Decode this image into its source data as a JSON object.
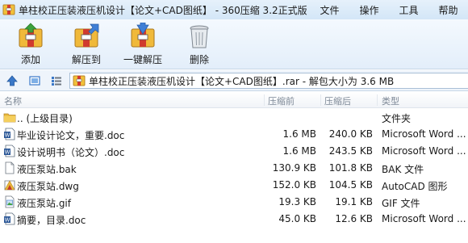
{
  "window": {
    "title": "单柱校正压装液压机设计【论文+CAD图纸】 - 360压缩 3.2正式版",
    "menu": [
      "文件",
      "操作",
      "工具",
      "帮助"
    ]
  },
  "toolbar": {
    "add_label": "添加",
    "extract_to_label": "解压到",
    "one_click_extract_label": "一键解压",
    "delete_label": "删除"
  },
  "address": {
    "path": "单柱校正压装液压机设计【论文+CAD图纸】.rar - 解包大小为 3.6 MB"
  },
  "columns": {
    "name": "名称",
    "packed": "压缩前",
    "unpacked": "压缩后",
    "type": "类型"
  },
  "files": [
    {
      "name": ".. (上级目录)",
      "packed": "",
      "unpacked": "",
      "type": "文件夹",
      "icon": "folder-icon"
    },
    {
      "name": "毕业设计论文，重要.doc",
      "packed": "1.6 MB",
      "unpacked": "240.0 KB",
      "type": "Microsoft Word ...",
      "icon": "word-document-icon"
    },
    {
      "name": "设计说明书（论文）.doc",
      "packed": "1.6 MB",
      "unpacked": "243.5 KB",
      "type": "Microsoft Word ...",
      "icon": "word-document-icon"
    },
    {
      "name": "液压泵站.bak",
      "packed": "130.9 KB",
      "unpacked": "101.8 KB",
      "type": "BAK 文件",
      "icon": "blank-file-icon"
    },
    {
      "name": "液压泵站.dwg",
      "packed": "152.0 KB",
      "unpacked": "104.5 KB",
      "type": "AutoCAD 图形",
      "icon": "autocad-file-icon"
    },
    {
      "name": "液压泵站.gif",
      "packed": "19.3 KB",
      "unpacked": "19.1 KB",
      "type": "GIF 文件",
      "icon": "image-file-icon"
    },
    {
      "name": "摘要，目录.doc",
      "packed": "45.0 KB",
      "unpacked": "12.6 KB",
      "type": "Microsoft Word ...",
      "icon": "word-document-icon"
    }
  ],
  "colors": {
    "titlebar": "#d3e6f7",
    "toolbar": "#e3eefa",
    "folder": "#e8b83b",
    "word": "#2b5797",
    "accent_blue": "#3a78c8"
  }
}
